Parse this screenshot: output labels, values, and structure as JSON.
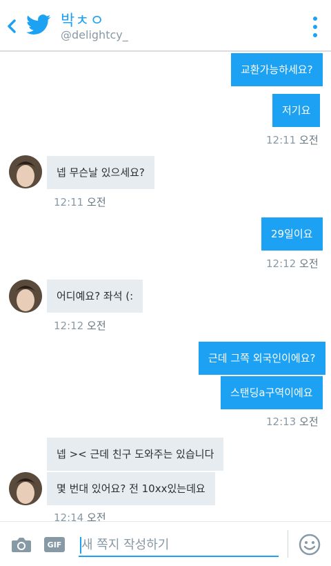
{
  "header": {
    "title": "박ㅊㅇ",
    "handle": "@delightcy_"
  },
  "icons": {
    "back": "chevron-left-icon",
    "logo": "twitter-bird-icon",
    "menu": "more-vertical-icon",
    "camera": "camera-icon",
    "emoji": "smiley-icon"
  },
  "messages": [
    {
      "from": "me",
      "text": "교환가능하세요?"
    },
    {
      "from": "me",
      "text": "저기요",
      "time": "12:11",
      "ampm": "오전"
    },
    {
      "from": "them",
      "text": "넵 무슨날 있으세요?",
      "time": "12:11",
      "ampm": "오전"
    },
    {
      "from": "me",
      "text": "29일이요",
      "time": "12:12",
      "ampm": "오전"
    },
    {
      "from": "them",
      "text": "어디예요? 좌석 (:",
      "time": "12:12",
      "ampm": "오전"
    },
    {
      "from": "me",
      "text": "근데 그쪽 외국인이에요?"
    },
    {
      "from": "me",
      "text": "스탠딩a구역이에요",
      "time": "12:13",
      "ampm": "오전"
    },
    {
      "from": "them",
      "text": "넵 >< 근데 친구 도와주는 있습니다"
    },
    {
      "from": "them",
      "text": "몇 번대 있어요? 전 10xx있는데요",
      "time": "12:14",
      "ampm": "오전"
    }
  ],
  "composer": {
    "gif_label": "GIF",
    "placeholder": "새 쪽지 작성하기"
  },
  "colors": {
    "accent": "#1da1f2",
    "incoming_bubble": "#e6ecf0",
    "muted_text": "#8899a6"
  }
}
